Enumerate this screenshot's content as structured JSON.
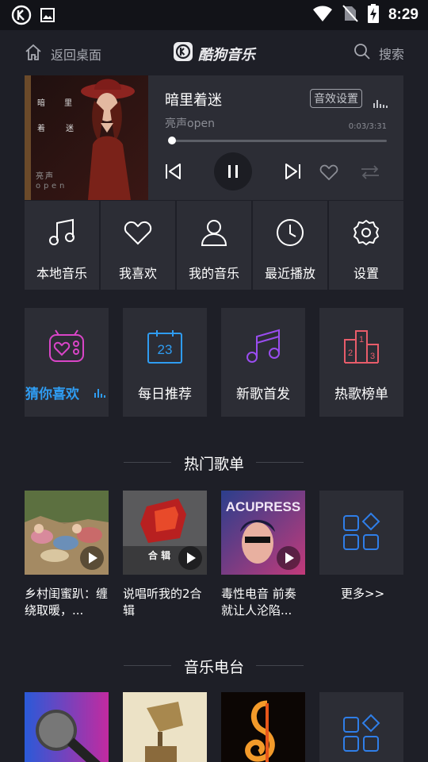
{
  "status_bar": {
    "time": "8:29"
  },
  "nav": {
    "back_label": "返回桌面",
    "app_name": "酷狗音乐",
    "search_label": "搜索"
  },
  "player": {
    "title": "暗里着迷",
    "artist": "亮声open",
    "fx_label": "音效设置",
    "elapsed": "0:03",
    "duration": "3:31",
    "time_text": "0:03/3:31",
    "progress_fraction": 0.014,
    "cover_text": [
      "暗",
      "里",
      "着",
      "迷",
      "亮",
      "声",
      "o",
      "p",
      "e",
      "n"
    ]
  },
  "quick_menu": [
    {
      "label": "本地音乐",
      "icon": "music-note-icon"
    },
    {
      "label": "我喜欢",
      "icon": "heart-icon"
    },
    {
      "label": "我的音乐",
      "icon": "user-icon"
    },
    {
      "label": "最近播放",
      "icon": "clock-icon"
    },
    {
      "label": "设置",
      "icon": "gear-icon"
    }
  ],
  "feature_cards": [
    {
      "label": "猜你喜欢",
      "icon": "radio-icon",
      "active": true
    },
    {
      "label": "每日推荐",
      "icon": "calendar-icon",
      "calendar_day": "23"
    },
    {
      "label": "新歌首发",
      "icon": "music-notes-icon"
    },
    {
      "label": "热歌榜单",
      "icon": "podium-icon",
      "podium": [
        "2",
        "1",
        "3"
      ]
    }
  ],
  "hot_playlists": {
    "title": "热门歌单",
    "items": [
      {
        "caption": "乡村闺蜜趴：缠绕取暖，..."
      },
      {
        "caption": "说唱听我的2合辑",
        "cover_text": "合 辑"
      },
      {
        "caption": "毒性电音 前奏就让人沦陷...",
        "cover_text": "ACUPRESS"
      },
      {
        "caption": "更多>>"
      }
    ]
  },
  "radio": {
    "title": "音乐电台"
  },
  "colors": {
    "accent": "#2f9cf1",
    "panel": "#2c2d35",
    "background": "#1e1f27"
  }
}
